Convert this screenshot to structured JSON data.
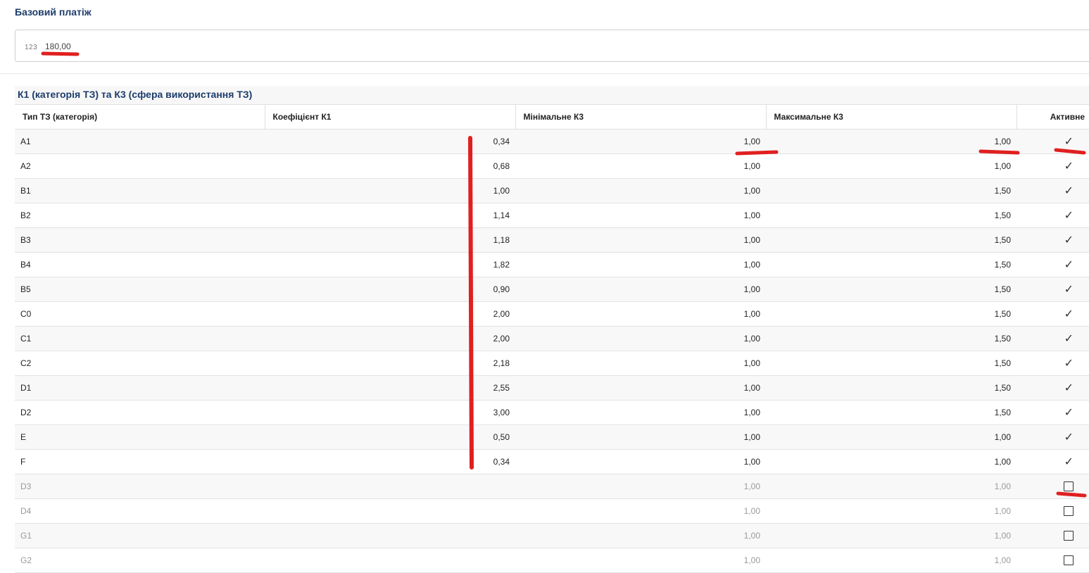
{
  "base_payment": {
    "label": "Базовий платіж",
    "icon": "123",
    "value": "180,00"
  },
  "section": {
    "title": "К1 (категорія ТЗ) та К3 (сфера використання ТЗ)",
    "columns": [
      "Тип ТЗ (категорія)",
      "Коефіцієнт К1",
      "Мінімальне К3",
      "Максимальне К3",
      "Активне"
    ]
  },
  "rows": [
    {
      "type": "A1",
      "k1": "0,34",
      "min": "1,00",
      "max": "1,00",
      "active": true
    },
    {
      "type": "A2",
      "k1": "0,68",
      "min": "1,00",
      "max": "1,00",
      "active": true
    },
    {
      "type": "B1",
      "k1": "1,00",
      "min": "1,00",
      "max": "1,50",
      "active": true
    },
    {
      "type": "B2",
      "k1": "1,14",
      "min": "1,00",
      "max": "1,50",
      "active": true
    },
    {
      "type": "B3",
      "k1": "1,18",
      "min": "1,00",
      "max": "1,50",
      "active": true
    },
    {
      "type": "B4",
      "k1": "1,82",
      "min": "1,00",
      "max": "1,50",
      "active": true
    },
    {
      "type": "B5",
      "k1": "0,90",
      "min": "1,00",
      "max": "1,50",
      "active": true
    },
    {
      "type": "C0",
      "k1": "2,00",
      "min": "1,00",
      "max": "1,50",
      "active": true
    },
    {
      "type": "C1",
      "k1": "2,00",
      "min": "1,00",
      "max": "1,50",
      "active": true
    },
    {
      "type": "C2",
      "k1": "2,18",
      "min": "1,00",
      "max": "1,50",
      "active": true
    },
    {
      "type": "D1",
      "k1": "2,55",
      "min": "1,00",
      "max": "1,50",
      "active": true
    },
    {
      "type": "D2",
      "k1": "3,00",
      "min": "1,00",
      "max": "1,50",
      "active": true
    },
    {
      "type": "E",
      "k1": "0,50",
      "min": "1,00",
      "max": "1,00",
      "active": true
    },
    {
      "type": "F",
      "k1": "0,34",
      "min": "1,00",
      "max": "1,00",
      "active": true
    },
    {
      "type": "D3",
      "k1": "",
      "min": "1,00",
      "max": "1,00",
      "active": false
    },
    {
      "type": "D4",
      "k1": "",
      "min": "1,00",
      "max": "1,00",
      "active": false
    },
    {
      "type": "G1",
      "k1": "",
      "min": "1,00",
      "max": "1,00",
      "active": false
    },
    {
      "type": "G2",
      "k1": "",
      "min": "1,00",
      "max": "1,00",
      "active": false
    }
  ],
  "annotation_color": "#e02020"
}
